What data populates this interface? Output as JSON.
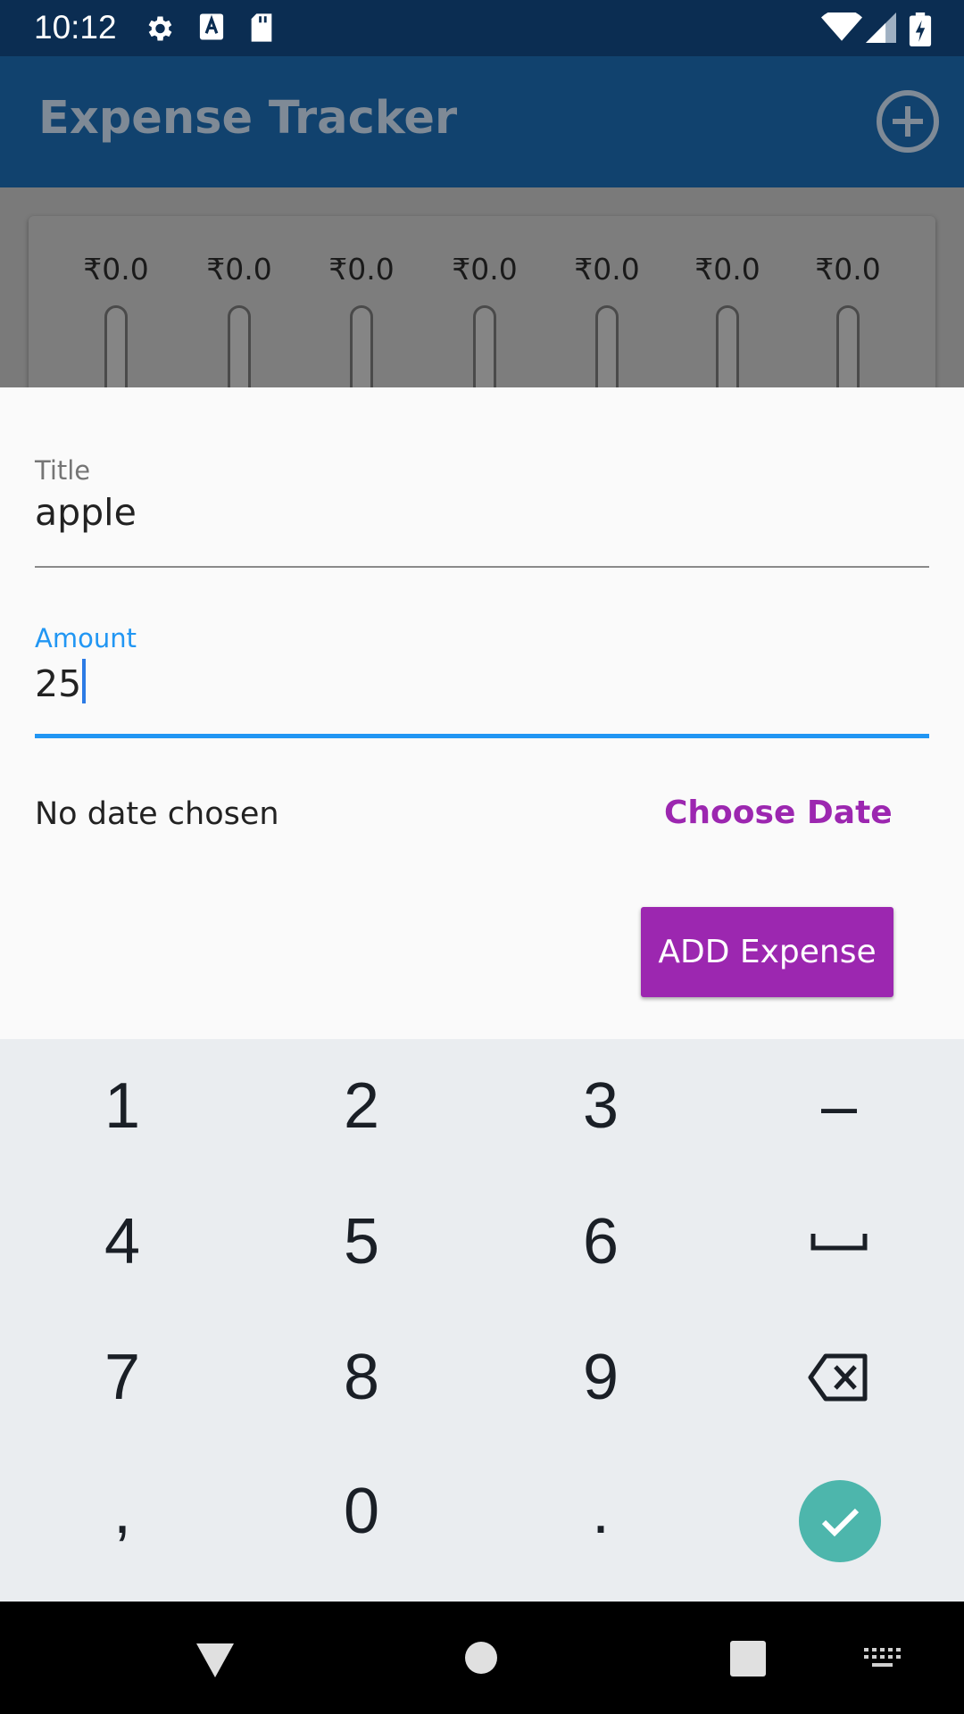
{
  "status_bar": {
    "time": "10:12",
    "left_icons": [
      "gear-icon",
      "a-box-icon",
      "sd-card-icon"
    ],
    "right_icons": [
      "wifi-icon",
      "signal-icon",
      "battery-charging-icon"
    ]
  },
  "app_bar": {
    "title": "Expense Tracker",
    "action_icon": "add-circle-icon"
  },
  "chart": {
    "bars": [
      {
        "label": "₹0.0",
        "fill": 0
      },
      {
        "label": "₹0.0",
        "fill": 0
      },
      {
        "label": "₹0.0",
        "fill": 0
      },
      {
        "label": "₹0.0",
        "fill": 0
      },
      {
        "label": "₹0.0",
        "fill": 0
      },
      {
        "label": "₹0.0",
        "fill": 0
      },
      {
        "label": "₹0.0",
        "fill": 0
      }
    ]
  },
  "form": {
    "title_label": "Title",
    "title_value": "apple",
    "amount_label": "Amount",
    "amount_value": "25",
    "date_status": "No date chosen",
    "choose_date_label": "Choose Date",
    "submit_label": "ADD Expense",
    "accent_color": "#9c27b0",
    "focus_color": "#2196f3"
  },
  "keyboard": {
    "rows": [
      [
        "1",
        "2",
        "3",
        "–"
      ],
      [
        "4",
        "5",
        "6",
        "space-icon"
      ],
      [
        "7",
        "8",
        "9",
        "backspace-icon"
      ],
      [
        ",",
        "0",
        ".",
        "check-icon"
      ]
    ],
    "done_color": "#4db6ac"
  },
  "nav_bar": {
    "buttons": [
      "back-icon",
      "home-icon",
      "recents-icon",
      "keyboard-switch-icon"
    ]
  }
}
